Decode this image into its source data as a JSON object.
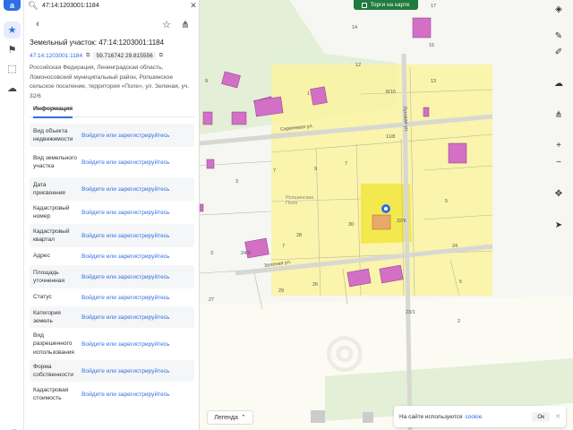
{
  "search": {
    "value": "47:14:1203001:1184"
  },
  "panel": {
    "title": "Земельный участок: 47:14:1203001:1184",
    "cadnum": "47:14:1203001:1184",
    "coords": "59.716742 29.815556",
    "address": "Российская Федерация, Ленинградская область, Ломоносовский муниципальный район, Ропшинское сельское поселение, территория «Поле», ул. Зеленая, уч. 32/6",
    "tab_info": "Информация",
    "rows": [
      {
        "k": "Вид объекта недвижимости",
        "v": "Войдите или зарегистрируйтесь"
      },
      {
        "k": "Вид земельного участка",
        "v": "Войдите или зарегистрируйтесь"
      },
      {
        "k": "Дата присвоения",
        "v": "Войдите или зарегистрируйтесь"
      },
      {
        "k": "Кадастровый номер",
        "v": "Войдите или зарегистрируйтесь"
      },
      {
        "k": "Кадастровый квартал",
        "v": "Войдите или зарегистрируйтесь"
      },
      {
        "k": "Адрес",
        "v": "Войдите или зарегистрируйтесь"
      },
      {
        "k": "Площадь уточненная",
        "v": "Войдите или зарегистрируйтесь"
      },
      {
        "k": "Статус",
        "v": "Войдите или зарегистрируйтесь"
      },
      {
        "k": "Категория земель",
        "v": "Войдите или зарегистрируйтесь"
      },
      {
        "k": "Вид разрешенного использования",
        "v": "Войдите или зарегистрируйтесь"
      },
      {
        "k": "Форма собственности",
        "v": "Войдите или зарегистрируйтесь"
      },
      {
        "k": "Кадастровая стоимость",
        "v": "Войдите или зарегистрируйтесь"
      }
    ]
  },
  "map": {
    "torgi": "Торги на карте",
    "legend": "Легенда",
    "cookie_text": "На сайте используются",
    "cookie_link": "cookie",
    "cookie_ok": "Ок",
    "streets": {
      "s1": "Сиреневая ул.",
      "s2": "Луговая ул.",
      "s3": "Зеленая ул.",
      "place": "Ропшинские Поля"
    },
    "labels": [
      "17",
      "14",
      "15",
      "12",
      "13",
      "8/10",
      "9",
      "11/8",
      "7",
      "5",
      "9",
      "7",
      "3",
      "30",
      "32/6",
      "28",
      "24",
      "7",
      "5",
      "3",
      "24/3",
      "26",
      "29",
      "27",
      "23/1",
      "2",
      "1",
      "6"
    ]
  },
  "colors": {
    "accent": "#2f6ee8",
    "parcel_fill": "#faf3a0",
    "building": "#d36fc5",
    "green": "#1f7a3e"
  }
}
